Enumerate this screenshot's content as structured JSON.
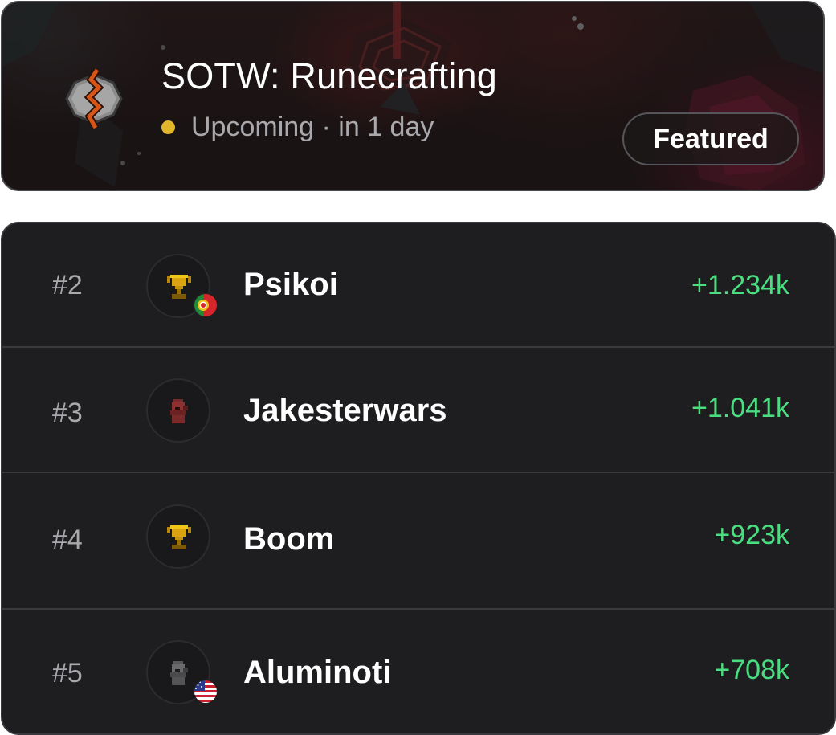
{
  "competition": {
    "title": "SOTW: Runecrafting",
    "status": "Upcoming · in 1 day",
    "status_color": "#e1b52c",
    "badge": "Featured",
    "icon": "runecrafting-skill-icon"
  },
  "leaderboard": {
    "gain_color": "#4ade80",
    "rows": [
      {
        "rank": "#2",
        "name": "Psikoi",
        "gain": "+1.234k",
        "avatar_icon": "trophy-gold-icon",
        "flag": "portugal-flag-icon"
      },
      {
        "rank": "#3",
        "name": "Jakesterwars",
        "gain": "+1.041k",
        "avatar_icon": "helmet-red-icon",
        "flag": ""
      },
      {
        "rank": "#4",
        "name": "Boom",
        "gain": "+923k",
        "avatar_icon": "trophy-gold-icon",
        "flag": ""
      },
      {
        "rank": "#5",
        "name": "Aluminoti",
        "gain": "+708k",
        "avatar_icon": "helmet-gray-icon",
        "flag": "usa-flag-icon"
      }
    ]
  }
}
